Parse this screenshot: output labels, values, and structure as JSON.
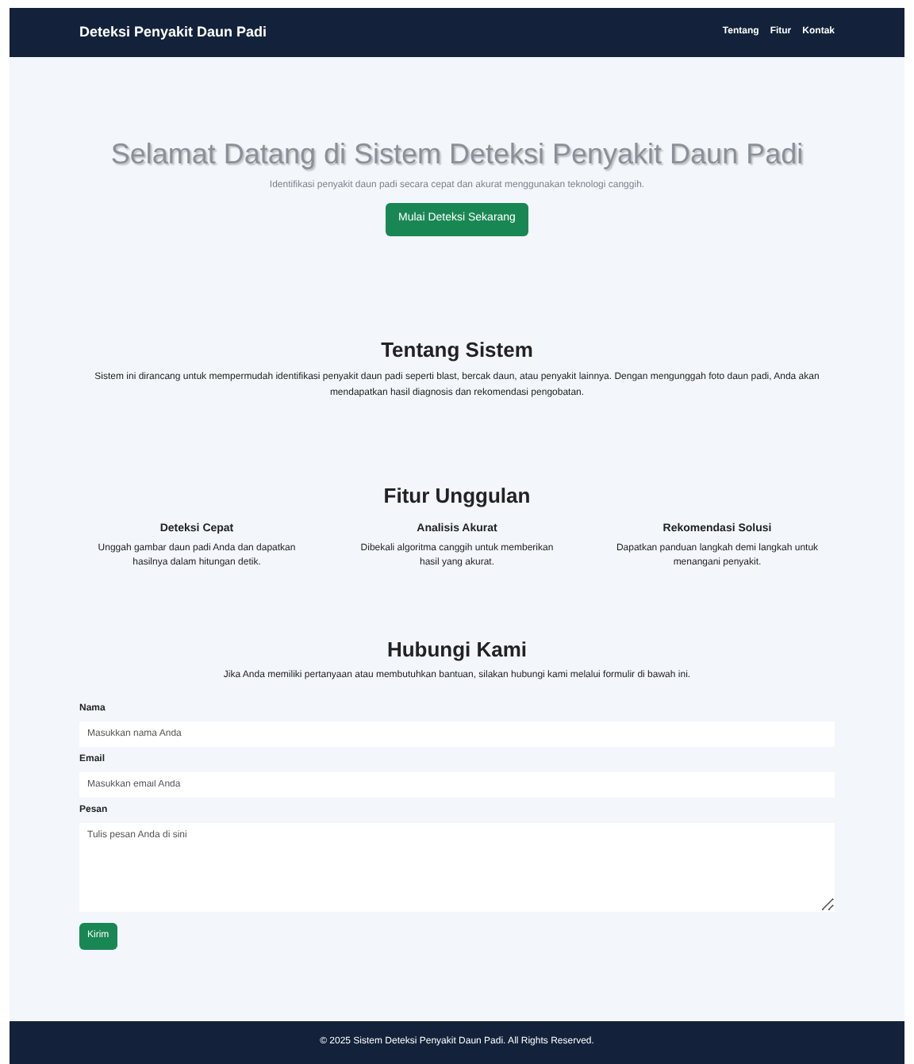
{
  "navbar": {
    "brand": "Deteksi Penyakit Daun Padi",
    "links": [
      "Tentang",
      "Fitur",
      "Kontak"
    ]
  },
  "hero": {
    "title": "Selamat Datang di Sistem Deteksi Penyakit Daun Padi",
    "subtitle": "Identifikasi penyakit daun padi secara cepat dan akurat menggunakan teknologi canggih.",
    "button": "Mulai Deteksi Sekarang"
  },
  "about": {
    "title": "Tentang Sistem",
    "text": "Sistem ini dirancang untuk mempermudah identifikasi penyakit daun padi seperti blast, bercak daun, atau penyakit lainnya. Dengan mengunggah foto daun padi, Anda akan mendapatkan hasil diagnosis dan rekomendasi pengobatan."
  },
  "features": {
    "title": "Fitur Unggulan",
    "items": [
      {
        "title": "Deteksi Cepat",
        "text": "Unggah gambar daun padi Anda dan dapatkan hasilnya dalam hitungan detik."
      },
      {
        "title": "Analisis Akurat",
        "text": "Dibekali algoritma canggih untuk memberikan hasil yang akurat."
      },
      {
        "title": "Rekomendasi Solusi",
        "text": "Dapatkan panduan langkah demi langkah untuk menangani penyakit."
      }
    ]
  },
  "contact": {
    "title": "Hubungi Kami",
    "text": "Jika Anda memiliki pertanyaan atau membutuhkan bantuan, silakan hubungi kami melalui formulir di bawah ini.",
    "fields": [
      {
        "kind": "input",
        "label": "Nama",
        "placeholder": "Masukkan nama Anda"
      },
      {
        "kind": "input",
        "label": "Email",
        "placeholder": "Masukkan email Anda"
      },
      {
        "kind": "textarea",
        "label": "Pesan",
        "placeholder": "Tulis pesan Anda di sini"
      }
    ],
    "button": "Kirim"
  },
  "footer": "© 2025 Sistem Deteksi Penyakit Daun Padi. All Rights Reserved."
}
